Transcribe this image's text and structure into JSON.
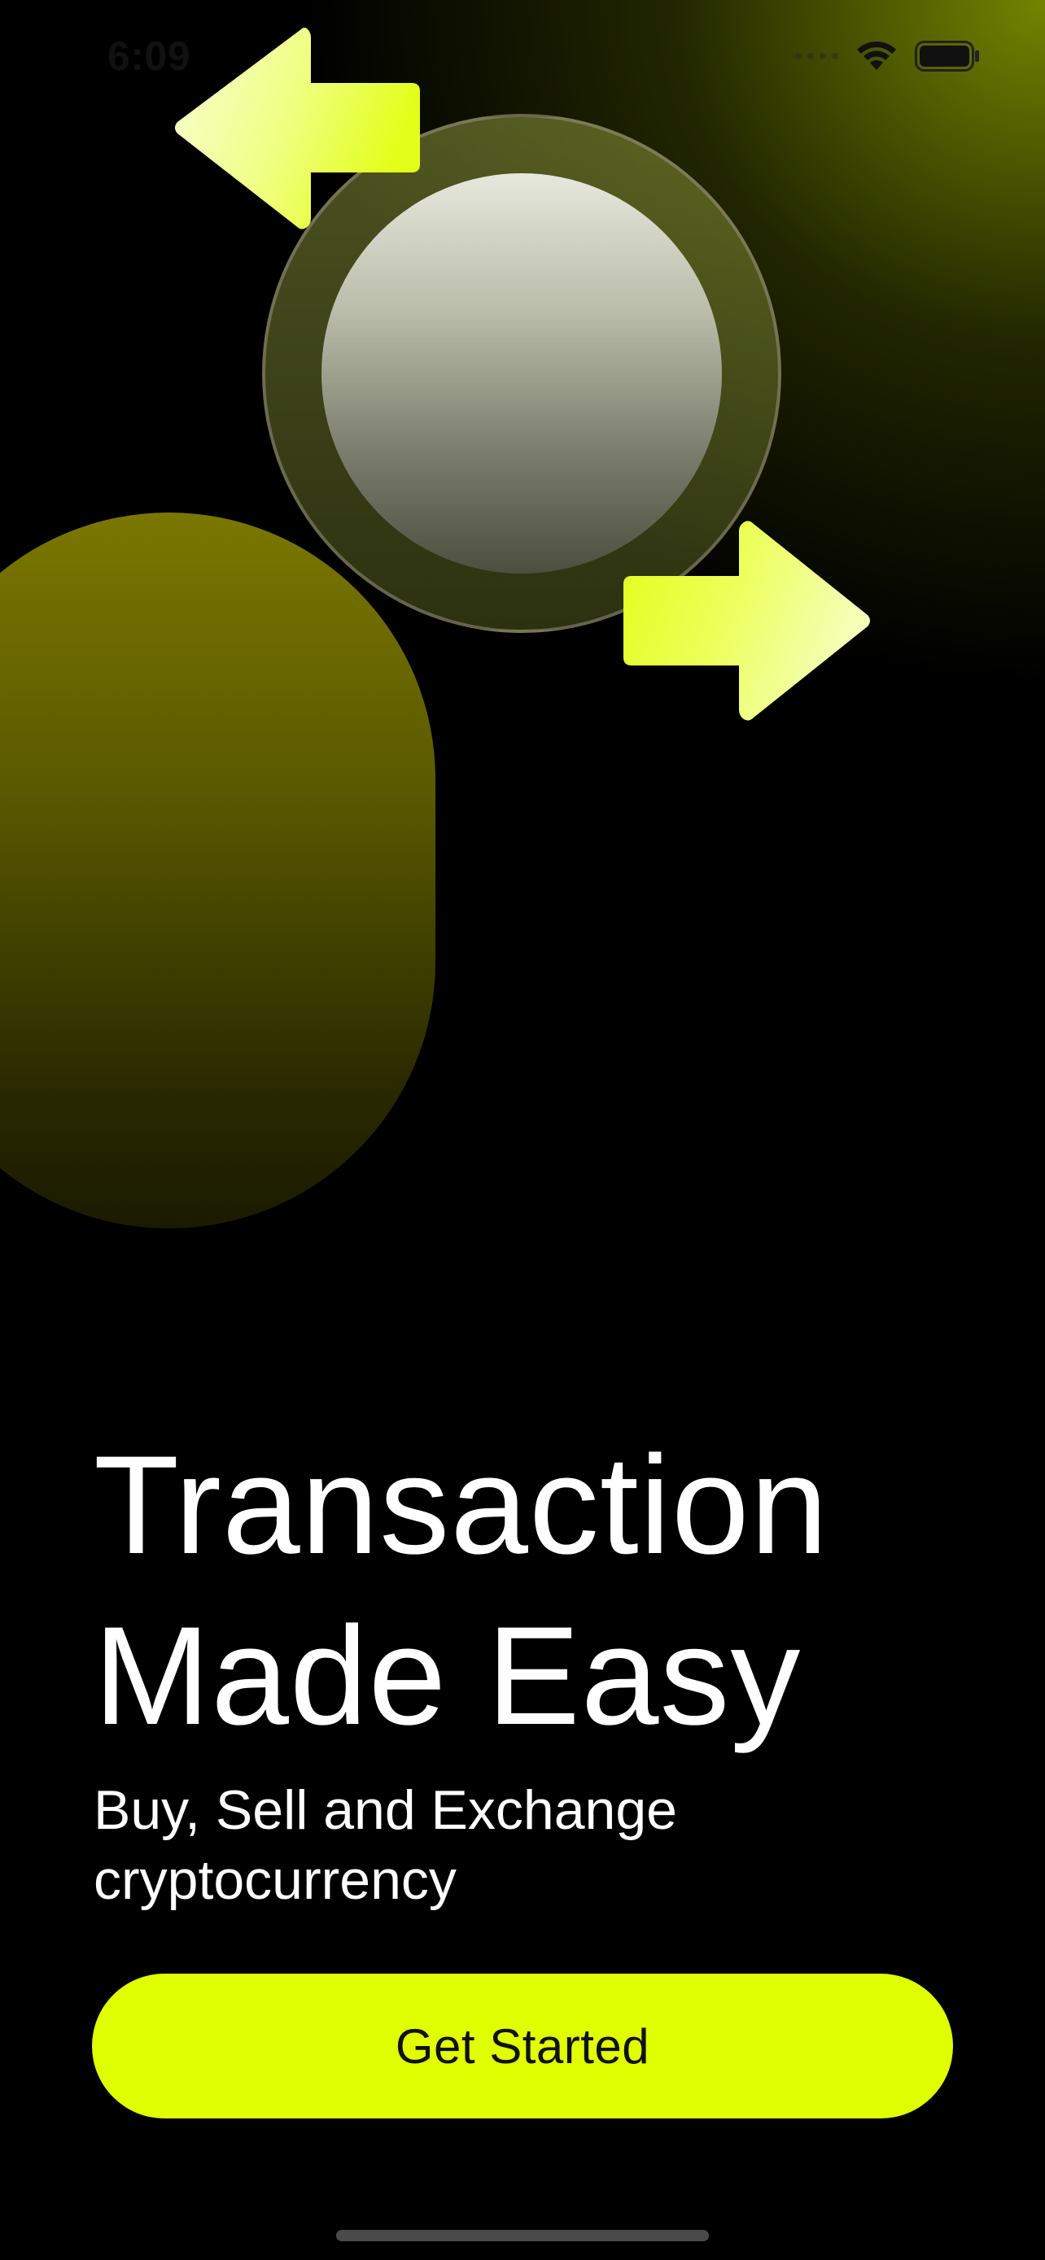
{
  "status_bar": {
    "time": "6:09",
    "icons": [
      "cellular-signal-icon",
      "wifi-icon",
      "battery-icon"
    ]
  },
  "hero": {
    "shapes": [
      "arrow-left-icon",
      "coin-icon",
      "arrow-right-icon",
      "pill-shape"
    ],
    "colors": {
      "accent": "#e0ff00",
      "arrow_light": "#f4ffc4",
      "pill": "#7a7700",
      "background": "#000000"
    }
  },
  "content": {
    "headline_line1": "Transaction",
    "headline_line2": "Made Easy",
    "subtitle_line1": "Buy, Sell and Exchange",
    "subtitle_line2": "cryptocurrency",
    "cta_label": "Get Started"
  }
}
